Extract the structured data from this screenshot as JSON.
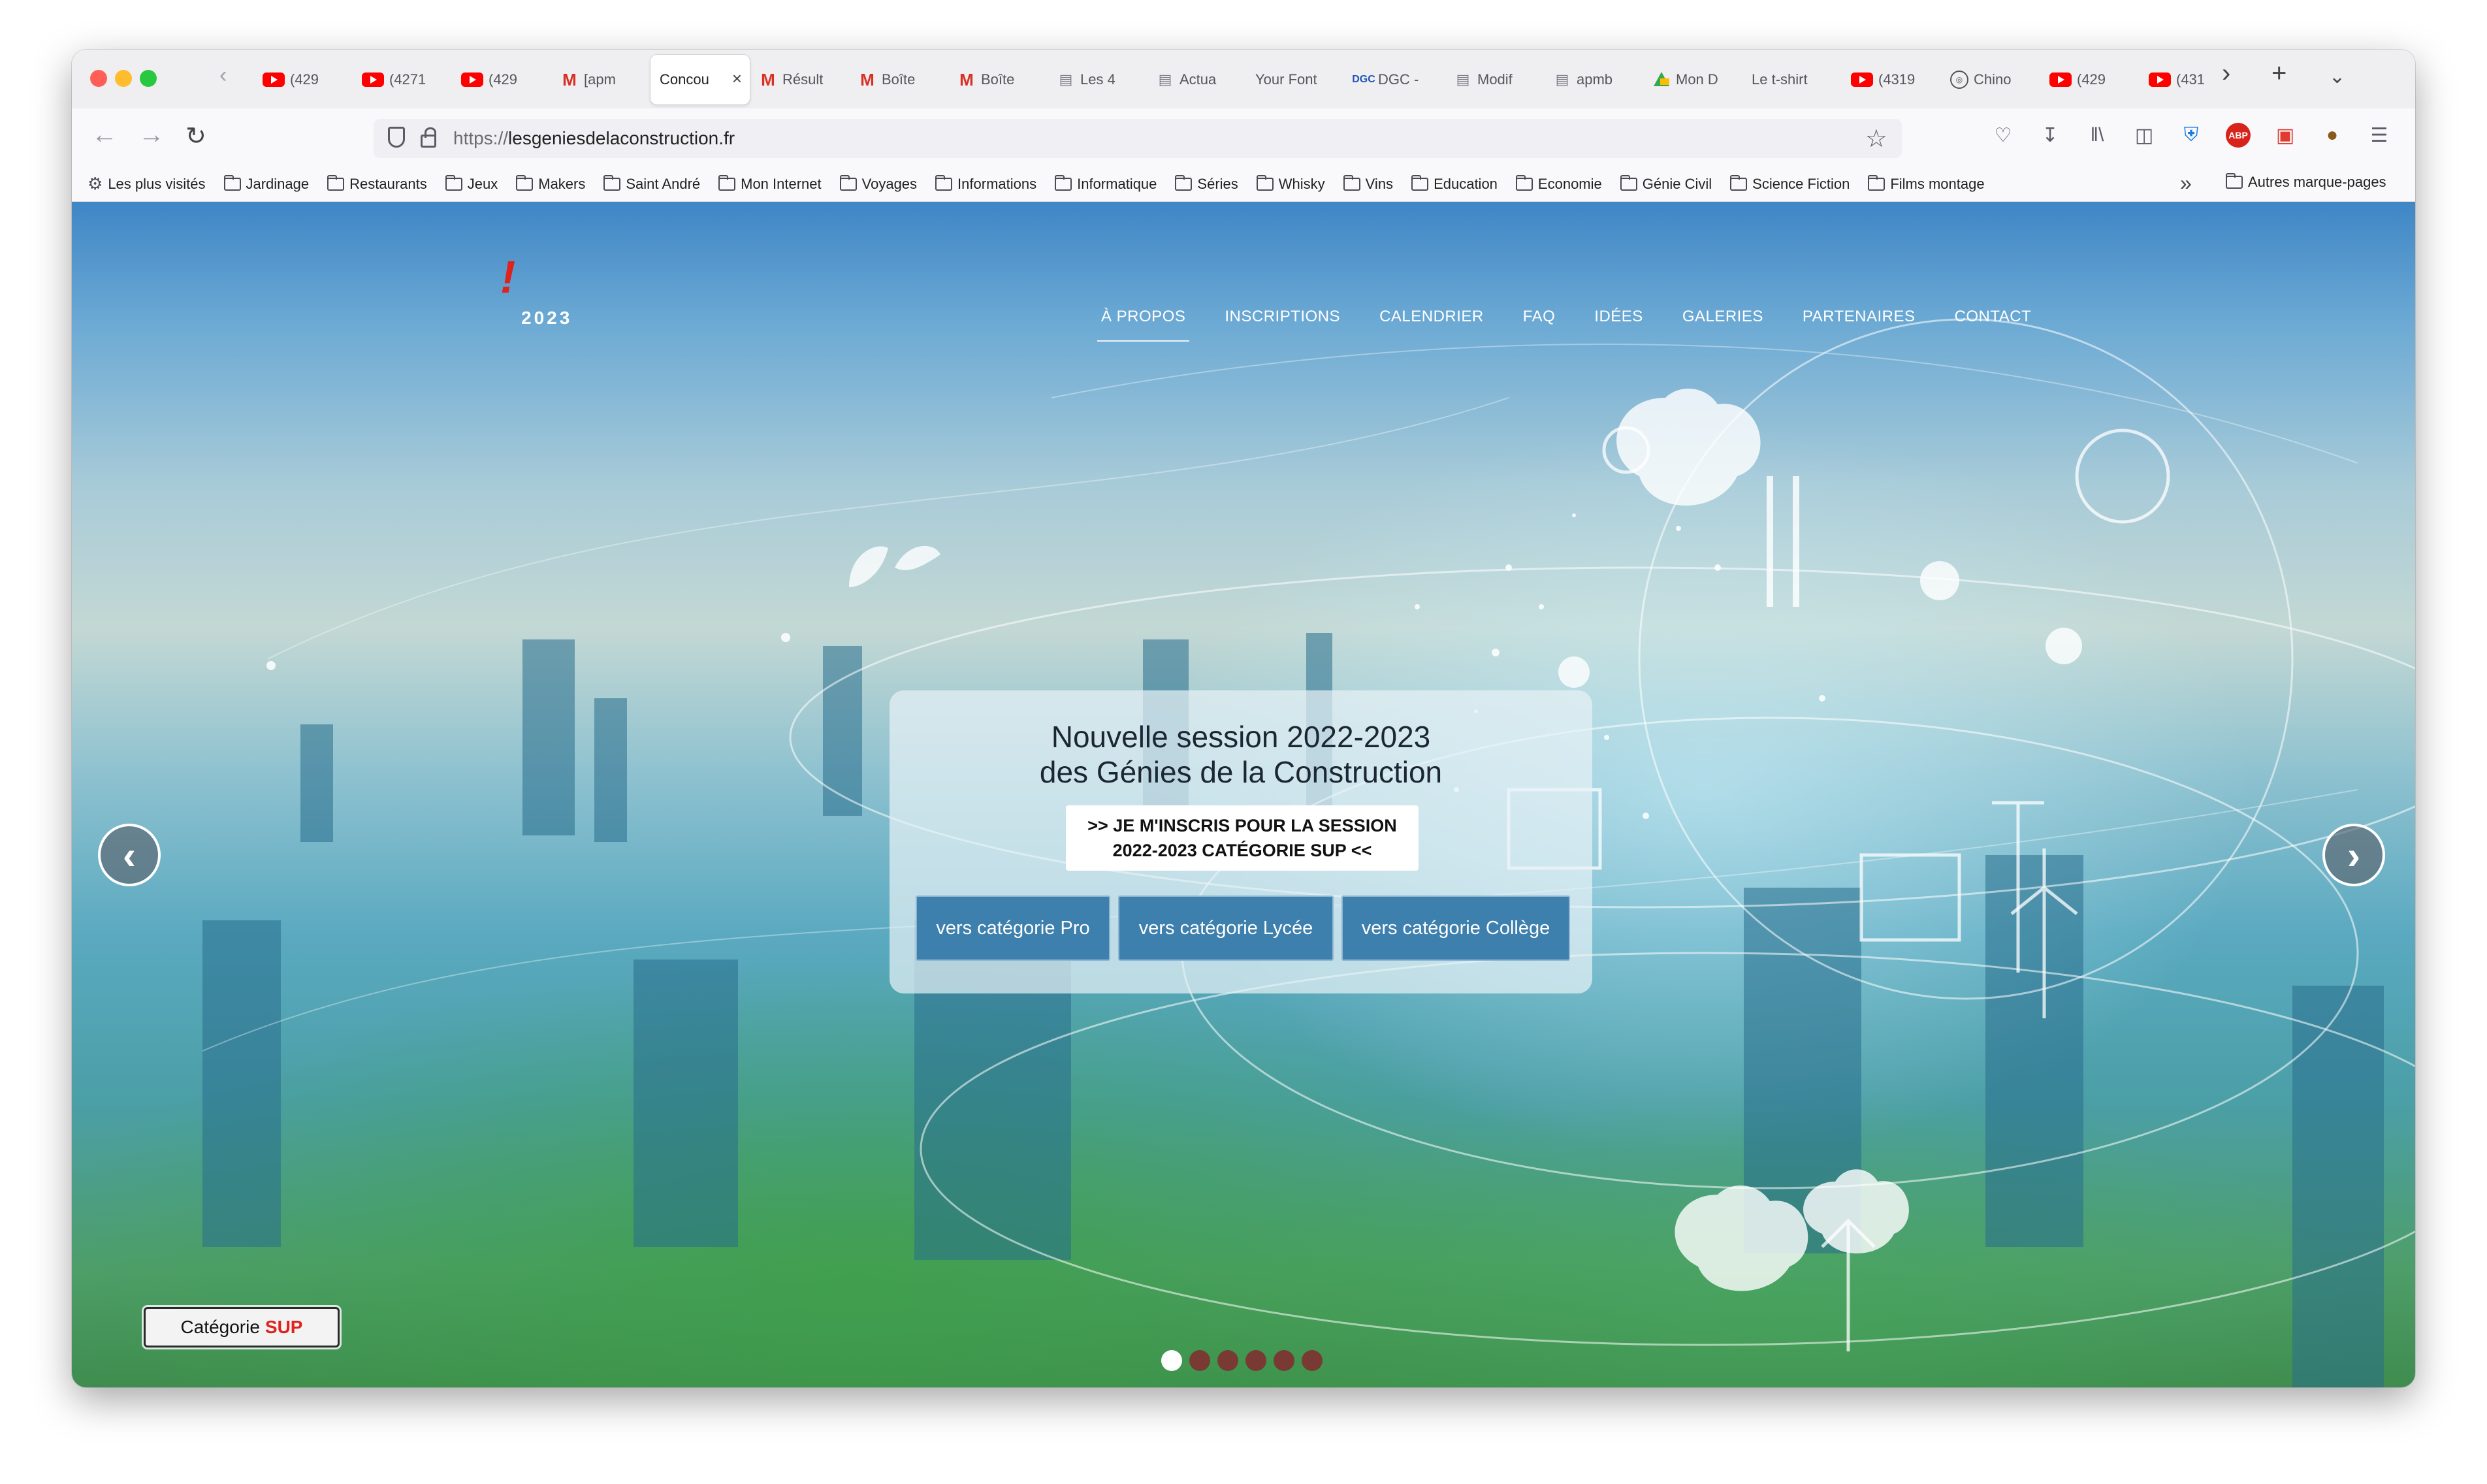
{
  "browser": {
    "tabs": [
      {
        "label": "(429",
        "favicon": "youtube-icon"
      },
      {
        "label": "(4271",
        "favicon": "youtube-icon"
      },
      {
        "label": "(429",
        "favicon": "youtube-icon"
      },
      {
        "label": "[apm",
        "favicon": "gmail-icon"
      },
      {
        "label": "Concou",
        "favicon": "",
        "active": true
      },
      {
        "label": "Résult",
        "favicon": "gmail-icon"
      },
      {
        "label": "Boîte",
        "favicon": "gmail-icon"
      },
      {
        "label": "Boîte",
        "favicon": "gmail-icon"
      },
      {
        "label": "Les 4",
        "favicon": "document-icon"
      },
      {
        "label": "Actua",
        "favicon": "document-icon"
      },
      {
        "label": "Your Font",
        "favicon": ""
      },
      {
        "label": "DGC -",
        "favicon": "dgc-icon"
      },
      {
        "label": "Modif",
        "favicon": "document-icon"
      },
      {
        "label": "apmb",
        "favicon": "document-icon"
      },
      {
        "label": "Mon D",
        "favicon": "drive-icon"
      },
      {
        "label": "Le t-shirt",
        "favicon": ""
      },
      {
        "label": "(4319",
        "favicon": "youtube-icon"
      },
      {
        "label": "Chino",
        "favicon": "circle-icon"
      },
      {
        "label": "(429",
        "favicon": "youtube-icon"
      },
      {
        "label": "(431",
        "favicon": "youtube-icon"
      }
    ],
    "tab_close_glyph": "×",
    "new_tab_glyph": "+",
    "url_protocol": "https://",
    "url_host": "lesgeniesdelaconstruction.fr",
    "bookmarks": [
      {
        "label": "Les plus visités",
        "icon": "gear-icon"
      },
      {
        "label": "Jardinage",
        "icon": "folder-icon"
      },
      {
        "label": "Restaurants",
        "icon": "folder-icon"
      },
      {
        "label": "Jeux",
        "icon": "folder-icon"
      },
      {
        "label": "Makers",
        "icon": "folder-icon"
      },
      {
        "label": "Saint André",
        "icon": "folder-icon"
      },
      {
        "label": "Mon Internet",
        "icon": "folder-icon"
      },
      {
        "label": "Voyages",
        "icon": "folder-icon"
      },
      {
        "label": "Informations",
        "icon": "folder-icon"
      },
      {
        "label": "Informatique",
        "icon": "folder-icon"
      },
      {
        "label": "Séries",
        "icon": "folder-icon"
      },
      {
        "label": "Whisky",
        "icon": "folder-icon"
      },
      {
        "label": "Vins",
        "icon": "folder-icon"
      },
      {
        "label": "Education",
        "icon": "folder-icon"
      },
      {
        "label": "Economie",
        "icon": "folder-icon"
      },
      {
        "label": "Génie Civil",
        "icon": "folder-icon"
      },
      {
        "label": "Science Fiction",
        "icon": "folder-icon"
      },
      {
        "label": "Films montage",
        "icon": "folder-icon"
      }
    ],
    "other_bookmarks": "Autres marque-pages",
    "toolbar_icons": [
      "pocket-icon",
      "download-icon",
      "library-icon",
      "sidebar-icon",
      "bitwarden-icon",
      "adblock-icon",
      "screenshot-icon",
      "extension-icon",
      "menu-icon"
    ],
    "abp_label": "ABP"
  },
  "site": {
    "logo_mark": "!",
    "logo_year": "2023",
    "nav": [
      {
        "label": "À PROPOS",
        "active": true
      },
      {
        "label": "INSCRIPTIONS"
      },
      {
        "label": "CALENDRIER"
      },
      {
        "label": "FAQ"
      },
      {
        "label": "IDÉES"
      },
      {
        "label": "GALERIES"
      },
      {
        "label": "PARTENAIRES"
      },
      {
        "label": "CONTACT"
      }
    ],
    "hero": {
      "title_line1": "Nouvelle session 2022-2023",
      "title_line2": "des Génies de la Construction",
      "signup_line1": ">> JE M'INSCRIS POUR LA SESSION",
      "signup_line2": "2022-2023 CATÉGORIE SUP <<",
      "cat_pro": "vers catégorie Pro",
      "cat_lycee": "vers catégorie Lycée",
      "cat_college": "vers catégorie Collège",
      "arrow_left": "‹",
      "arrow_right": "›"
    },
    "category_badge": {
      "prefix": "Catégorie",
      "highlight": "SUP"
    },
    "carousel": {
      "slide_count": 6,
      "active_index": 0
    },
    "colors": {
      "accent_red": "#e0221d",
      "button_blue": "#3d7fad"
    }
  }
}
